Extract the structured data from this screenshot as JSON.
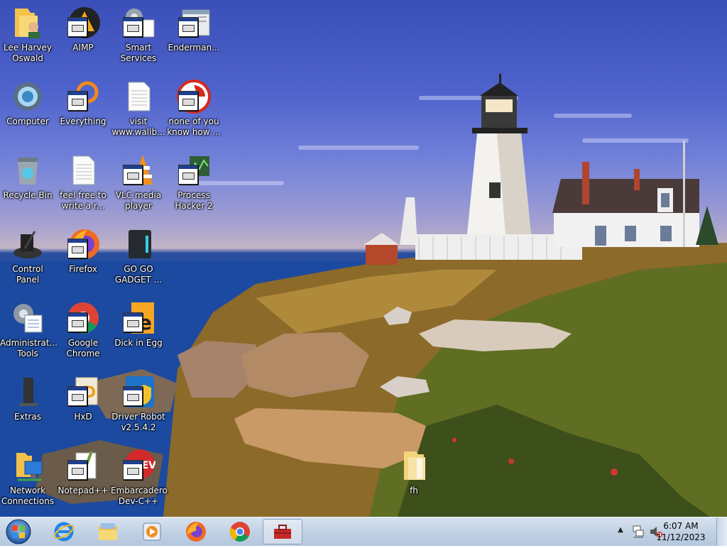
{
  "desktop": {
    "icons": [
      {
        "label": "Lee Harvey\nOswald",
        "icon": "folder-icon"
      },
      {
        "label": "AIMP",
        "icon": "aimp-icon"
      },
      {
        "label": "Smart\nServices",
        "icon": "smart-services-icon"
      },
      {
        "label": "Enderman...",
        "icon": "enderman-icon"
      },
      {
        "label": "Computer",
        "icon": "computer-icon"
      },
      {
        "label": "Everything",
        "icon": "everything-icon"
      },
      {
        "label": "visit\nwww.wallb...",
        "icon": "text-document-icon"
      },
      {
        "label": "none of you\nknow how ...",
        "icon": "app-icon"
      },
      {
        "label": "Recycle Bin",
        "icon": "recycle-bin-icon"
      },
      {
        "label": "feel free to\nwrite a r...",
        "icon": "text-document-icon"
      },
      {
        "label": "VLC media\nplayer",
        "icon": "vlc-icon"
      },
      {
        "label": "Process\nHacker 2",
        "icon": "process-hacker-icon"
      },
      {
        "label": "Control Panel",
        "icon": "control-panel-icon"
      },
      {
        "label": "Firefox",
        "icon": "firefox-icon"
      },
      {
        "label": "GO GO\nGADGET ...",
        "icon": "gadget-icon"
      },
      {
        "label": "Administrat...\nTools",
        "icon": "admin-tools-icon"
      },
      {
        "label": "Google\nChrome",
        "icon": "chrome-icon"
      },
      {
        "label": "Dick in Egg",
        "icon": "dick-in-egg-icon"
      },
      {
        "label": "Extras",
        "icon": "extras-icon"
      },
      {
        "label": "HxD",
        "icon": "hxd-icon"
      },
      {
        "label": "Driver Robot\nv2.5.4.2",
        "icon": "driver-robot-icon"
      },
      {
        "label": "Network\nConnections",
        "icon": "network-connections-icon"
      },
      {
        "label": "Notepad++",
        "icon": "notepad-plus-plus-icon"
      },
      {
        "label": "Embarcadero\nDev-C++",
        "icon": "dev-cpp-icon"
      },
      {
        "label": "fh",
        "icon": "folder-icon"
      }
    ]
  },
  "taskbar": {
    "items": [
      {
        "name": "internet-explorer-icon"
      },
      {
        "name": "windows-explorer-icon"
      },
      {
        "name": "media-player-icon"
      },
      {
        "name": "firefox-icon"
      },
      {
        "name": "chrome-icon"
      },
      {
        "name": "toolbox-app-icon"
      }
    ],
    "clock": {
      "time": "6:07 AM",
      "date": "11/12/2023"
    }
  },
  "colors": {
    "accent": "#1f3f8f",
    "taskbar": "#c2d2e4"
  }
}
